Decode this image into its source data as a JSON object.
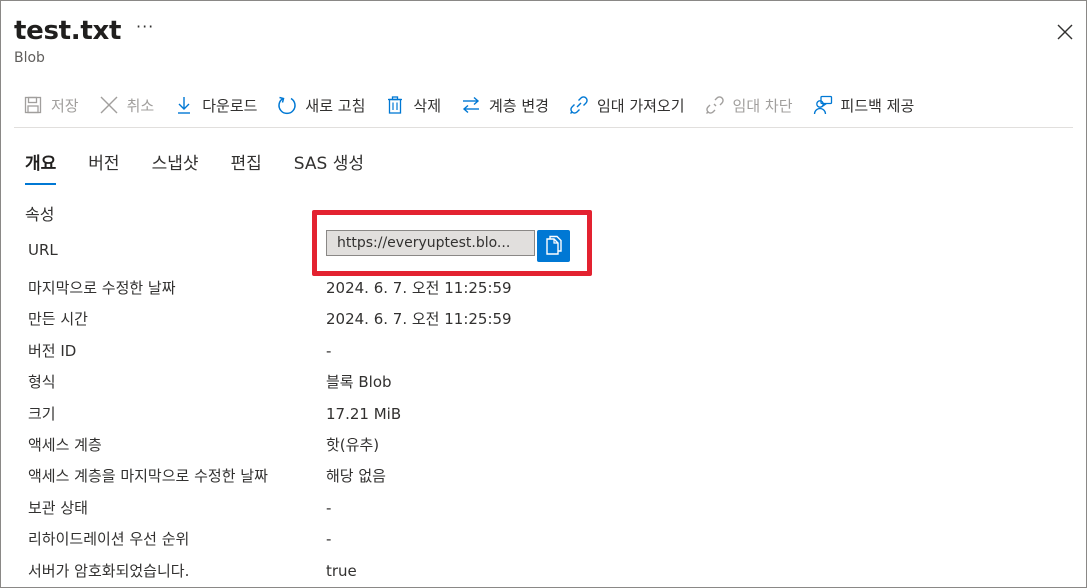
{
  "header": {
    "title": "test.txt",
    "more": "···",
    "subtitle": "Blob"
  },
  "toolbar": {
    "save": "저장",
    "cancel": "취소",
    "download": "다운로드",
    "refresh": "새로 고침",
    "delete": "삭제",
    "change_tier": "계층 변경",
    "acquire_lease": "임대 가져오기",
    "break_lease": "임대 차단",
    "feedback": "피드백 제공"
  },
  "tabs": [
    "개요",
    "버전",
    "스냅샷",
    "편집",
    "SAS 생성"
  ],
  "section_title": "속성",
  "url": {
    "label": "URL",
    "value": "https://everyuptest.blo..."
  },
  "properties": [
    {
      "label": "마지막으로 수정한 날짜",
      "value": "2024. 6. 7. 오전 11:25:59"
    },
    {
      "label": "만든 시간",
      "value": "2024. 6. 7. 오전 11:25:59"
    },
    {
      "label": "버전 ID",
      "value": "-"
    },
    {
      "label": "형식",
      "value": "블록 Blob"
    },
    {
      "label": "크기",
      "value": "17.21 MiB"
    },
    {
      "label": "액세스 계층",
      "value": "핫(유추)"
    },
    {
      "label": "액세스 계층을 마지막으로 수정한 날짜",
      "value": "해당 없음"
    },
    {
      "label": "보관 상태",
      "value": "-"
    },
    {
      "label": "리하이드레이션 우선 순위",
      "value": "-"
    },
    {
      "label": "서버가 암호화되었습니다.",
      "value": "true"
    }
  ],
  "colors": {
    "accent": "#0078d4",
    "highlight": "#e32230"
  },
  "icons": {
    "save": "save-icon",
    "cancel": "cancel-x-icon",
    "download": "download-arrow-icon",
    "refresh": "refresh-icon",
    "delete": "trash-icon",
    "change_tier": "swap-arrows-icon",
    "acquire_lease": "link-icon",
    "break_lease": "broken-link-icon",
    "feedback": "feedback-person-icon",
    "copy": "copy-icon",
    "close": "close-icon"
  }
}
